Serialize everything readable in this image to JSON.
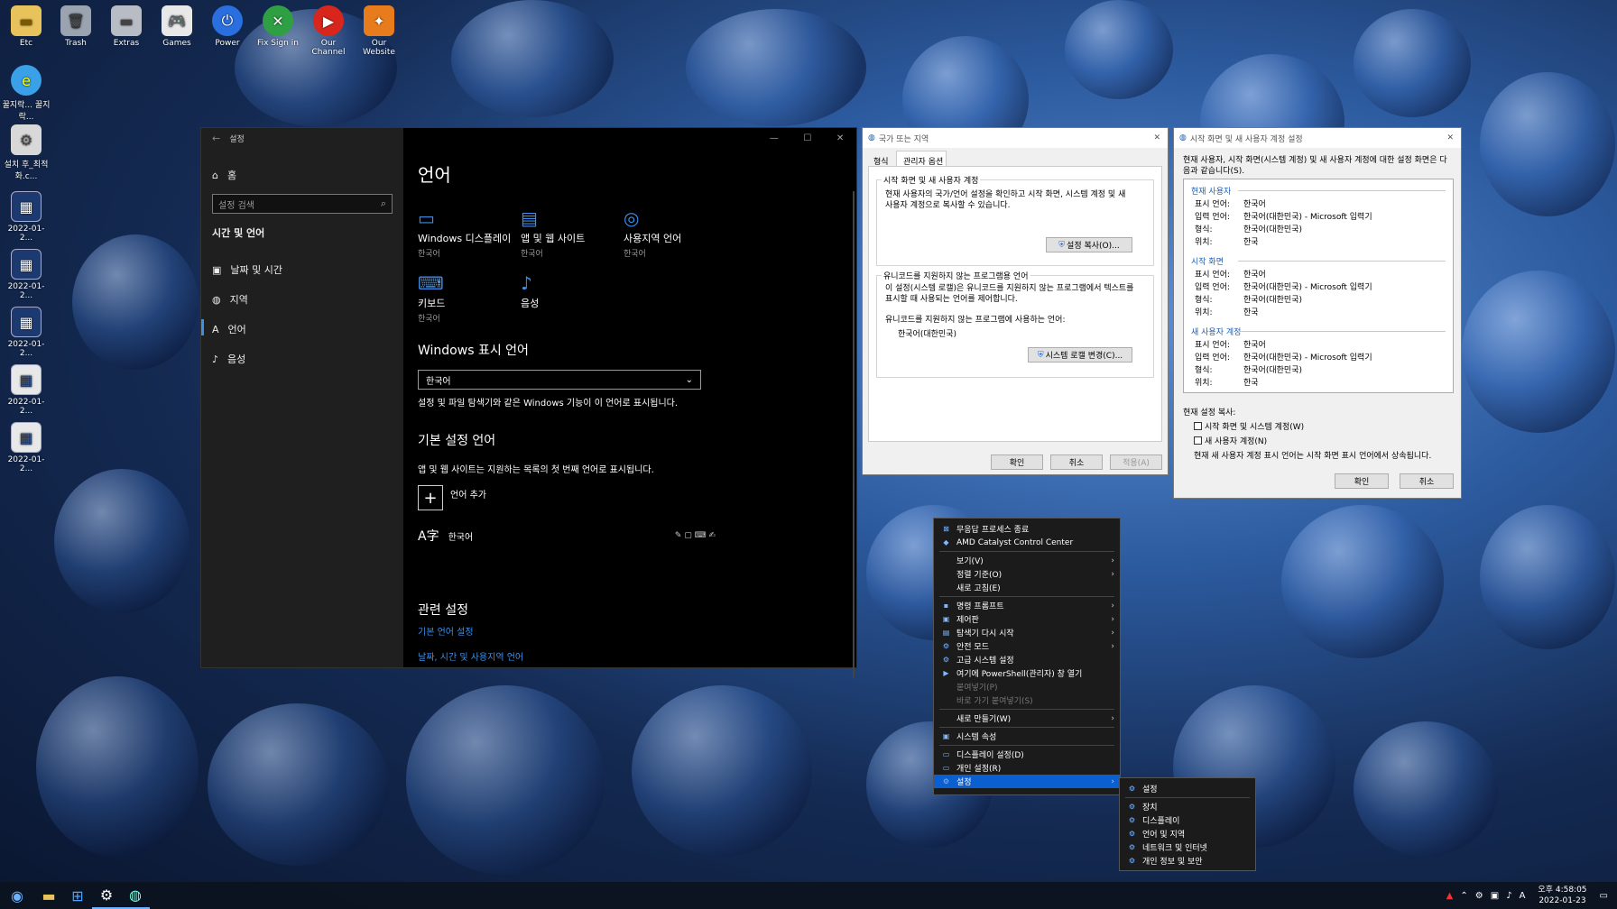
{
  "desktop_icons": [
    {
      "label": "Etc",
      "icon": "folder-icon"
    },
    {
      "label": "Trash",
      "icon": "trash-icon"
    },
    {
      "label": "Extras",
      "icon": "folder-icon"
    },
    {
      "label": "Games",
      "icon": "gamepad-icon"
    },
    {
      "label": "Power",
      "icon": "power-icon"
    },
    {
      "label": "Fix Sign in",
      "icon": "xbox-icon"
    },
    {
      "label": "Our Channel",
      "icon": "youtube-icon"
    },
    {
      "label": "Our Website",
      "icon": "website-icon"
    },
    {
      "label": "꿀지락... 꿀지락...",
      "icon": "ie-icon"
    },
    {
      "label": "설치 후_최적화.c...",
      "icon": "settings-file-icon"
    },
    {
      "label": "2022-01-2...",
      "icon": "screenshot-icon"
    },
    {
      "label": "2022-01-2...",
      "icon": "screenshot-icon"
    },
    {
      "label": "2022-01-2...",
      "icon": "screenshot-icon"
    },
    {
      "label": "2022-01-2...",
      "icon": "screenshot-icon"
    },
    {
      "label": "2022-01-2...",
      "icon": "screenshot-icon"
    }
  ],
  "settings": {
    "title": "설정",
    "home": "홈",
    "search_placeholder": "설정 검색",
    "section": "시간 및 언어",
    "nav": [
      "날짜 및 시간",
      "지역",
      "언어",
      "음성"
    ],
    "page_title": "언어",
    "categories": [
      {
        "name": "Windows 디스플레이",
        "sub": "한국어"
      },
      {
        "name": "앱 및 웹 사이트",
        "sub": "한국어"
      },
      {
        "name": "사용지역 언어",
        "sub": "한국어"
      },
      {
        "name": "키보드",
        "sub": "한국어"
      },
      {
        "name": "음성",
        "sub": ""
      }
    ],
    "display_lang_heading": "Windows 표시 언어",
    "display_lang_value": "한국어",
    "display_lang_desc": "설정 및 파일 탐색기와 같은 Windows 기능이 이 언어로 표시됩니다.",
    "pref_heading": "기본 설정 언어",
    "pref_desc": "앱 및 웹 사이트는 지원하는 목록의 첫 번째 언어로 표시됩니다.",
    "add_lang": "언어 추가",
    "lang_item": "한국어",
    "related_heading": "관련 설정",
    "related_links": [
      "기본 언어 설정",
      "날짜, 시간 및 사용지역 언어"
    ]
  },
  "region_dialog": {
    "title": "국가 또는 지역",
    "tabs": [
      "형식",
      "관리자 옵션"
    ],
    "group1_title": "시작 화면 및 새 사용자 계정",
    "group1_desc": "현재 사용자의 국가/언어 설정을 확인하고 시작 화면, 시스템 계정 및 새 사용자 계정으로 복사할 수 있습니다.",
    "copy_btn": "설정 복사(O)...",
    "group2_title": "유니코드를 지원하지 않는 프로그램용 언어",
    "group2_desc": "이 설정(시스템 로캘)은 유니코드를 지원하지 않는 프로그램에서 텍스트를 표시할 때 사용되는 언어를 제어합니다.",
    "current_label": "유니코드를 지원하지 않는 프로그램에 사용하는 언어:",
    "current_value": "한국어(대한민국)",
    "locale_btn": "시스템 로캘 변경(C)...",
    "ok": "확인",
    "cancel": "취소",
    "apply": "적용(A)"
  },
  "copy_dialog": {
    "title": "시작 화면 및 새 사용자 계정 설정",
    "intro": "현재 사용자, 시작 화면(시스템 계정) 및 새 사용자 계정에 대한 설정 화면은 다음과 같습니다(S).",
    "sections": [
      {
        "name": "현재 사용자",
        "rows": [
          [
            "표시 언어:",
            "한국어"
          ],
          [
            "입력 언어:",
            "한국어(대한민국) - Microsoft 입력기"
          ],
          [
            "형식:",
            "한국어(대한민국)"
          ],
          [
            "위치:",
            "한국"
          ]
        ]
      },
      {
        "name": "시작 화면",
        "rows": [
          [
            "표시 언어:",
            "한국어"
          ],
          [
            "입력 언어:",
            "한국어(대한민국) - Microsoft 입력기"
          ],
          [
            "형식:",
            "한국어(대한민국)"
          ],
          [
            "위치:",
            "한국"
          ]
        ]
      },
      {
        "name": "새 사용자 계정",
        "rows": [
          [
            "표시 언어:",
            "한국어"
          ],
          [
            "입력 언어:",
            "한국어(대한민국) - Microsoft 입력기"
          ],
          [
            "형식:",
            "한국어(대한민국)"
          ],
          [
            "위치:",
            "한국"
          ]
        ]
      }
    ],
    "copy_label": "현재 설정 복사:",
    "chk1": "시작 화면 및 시스템 계정(W)",
    "chk2": "새 사용자 계정(N)",
    "note": "현재 새 사용자 계정 표시 언어는 시작 화면 표시 언어에서 상속됩니다.",
    "ok": "확인",
    "cancel": "취소"
  },
  "context_menu": {
    "items": [
      "무응답 프로세스 종료",
      "AMD Catalyst Control Center",
      "보기(V)",
      "정렬 기준(O)",
      "새로 고침(E)",
      "명령 프롬프트",
      "제어판",
      "탐색기 다시 시작",
      "안전 모드",
      "고급 시스템 설정",
      "여기에 PowerShell(관리자) 창 열기",
      "붙여넣기(P)",
      "바로 가기 붙여넣기(S)",
      "새로 만들기(W)",
      "시스템 속성",
      "디스플레이 설정(D)",
      "개인 설정(R)",
      "설정"
    ]
  },
  "submenu": {
    "items": [
      "설정",
      "장치",
      "디스플레이",
      "언어 및 지역",
      "네트워크 및 인터넷",
      "개인 정보 및 보안"
    ]
  },
  "taskbar": {
    "time": "오후 4:58:05",
    "date": "2022-01-23",
    "ime": "A"
  },
  "colors": {
    "accent": "#3d8ee6",
    "menu_sel": "#0a5fd1"
  }
}
